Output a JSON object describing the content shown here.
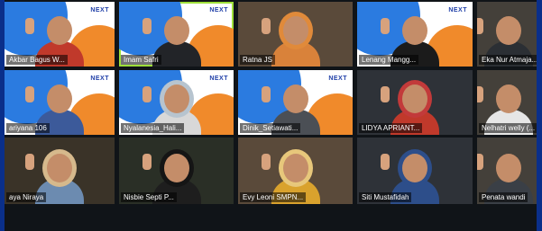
{
  "meeting": {
    "brand_logo_text": "NEXT",
    "participants": [
      {
        "name": "Akbar Bagus W...",
        "brand": true,
        "active": false,
        "shirt": "#c0392b",
        "scarf": null
      },
      {
        "name": "Imam Safri",
        "brand": true,
        "active": true,
        "shirt": "#222428",
        "scarf": null
      },
      {
        "name": "Ratna JS",
        "brand": false,
        "active": false,
        "shirt": "#d9823a",
        "scarf": "#e08a3a"
      },
      {
        "name": "Lenang Mangg...",
        "brand": true,
        "active": false,
        "shirt": "#1b1b1b",
        "scarf": null
      },
      {
        "name": "Eka Nur Atmaja...",
        "brand": false,
        "active": false,
        "shirt": "#2b2f34",
        "scarf": null
      },
      {
        "name": "ariyana 106",
        "brand": true,
        "active": false,
        "shirt": "#3c5a9a",
        "scarf": null
      },
      {
        "name": "Nyalanesia_Hali...",
        "brand": true,
        "active": false,
        "shirt": "#d8d8d8",
        "scarf": "#b7c4cf"
      },
      {
        "name": "Dinik_Setiawati...",
        "brand": true,
        "active": false,
        "shirt": "#4b4f55",
        "scarf": null
      },
      {
        "name": "LIDYA APRIANT...",
        "brand": false,
        "active": false,
        "shirt": "#c0392b",
        "scarf": "#c23a3a"
      },
      {
        "name": "Nelhatri welly (...",
        "brand": false,
        "active": false,
        "shirt": "#e6e6e6",
        "scarf": null
      },
      {
        "name": "aya Niraya",
        "brand": false,
        "active": false,
        "shirt": "#6c8bb0",
        "scarf": "#d6b98c"
      },
      {
        "name": "Nisbie Septi P...",
        "brand": false,
        "active": false,
        "shirt": "#1e1e1e",
        "scarf": "#151515"
      },
      {
        "name": "Evy Leoni SMPN...",
        "brand": false,
        "active": false,
        "shirt": "#d9a22d",
        "scarf": "#e7c77b"
      },
      {
        "name": "Siti Mustafidah",
        "brand": false,
        "active": false,
        "shirt": "#2d4e8a",
        "scarf": "#2d4e8a"
      },
      {
        "name": "Penata wandi",
        "brand": false,
        "active": false,
        "shirt": "#3a3f46",
        "scarf": null
      }
    ]
  }
}
